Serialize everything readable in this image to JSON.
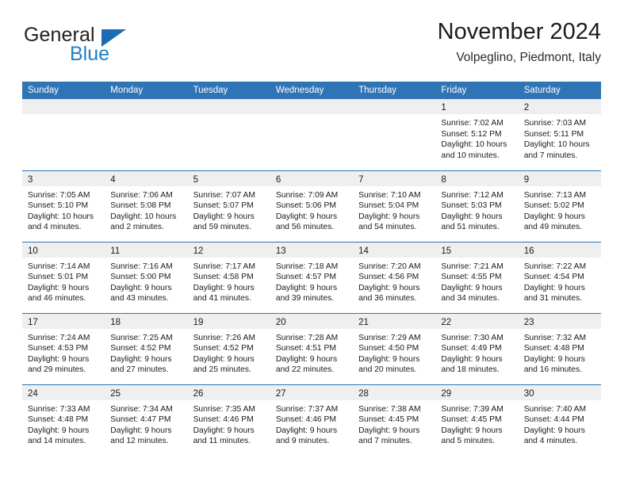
{
  "brand": {
    "word1": "General",
    "word2": "Blue",
    "flag_color": "#1b6cb0",
    "blue_text_color": "#1d80c4"
  },
  "header": {
    "title": "November 2024",
    "subtitle": "Volpeglino, Piedmont, Italy"
  },
  "theme": {
    "header_blue": "#2f74b5",
    "daynum_band_gray": "#efefef",
    "text_color": "#1a1a1a"
  },
  "calendar": {
    "weekday_headers": [
      "Sunday",
      "Monday",
      "Tuesday",
      "Wednesday",
      "Thursday",
      "Friday",
      "Saturday"
    ],
    "weeks": [
      [
        {
          "empty": true
        },
        {
          "empty": true
        },
        {
          "empty": true
        },
        {
          "empty": true
        },
        {
          "empty": true
        },
        {
          "day": "1",
          "sunrise": "Sunrise: 7:02 AM",
          "sunset": "Sunset: 5:12 PM",
          "daylight1": "Daylight: 10 hours",
          "daylight2": "and 10 minutes."
        },
        {
          "day": "2",
          "sunrise": "Sunrise: 7:03 AM",
          "sunset": "Sunset: 5:11 PM",
          "daylight1": "Daylight: 10 hours",
          "daylight2": "and 7 minutes."
        }
      ],
      [
        {
          "day": "3",
          "sunrise": "Sunrise: 7:05 AM",
          "sunset": "Sunset: 5:10 PM",
          "daylight1": "Daylight: 10 hours",
          "daylight2": "and 4 minutes."
        },
        {
          "day": "4",
          "sunrise": "Sunrise: 7:06 AM",
          "sunset": "Sunset: 5:08 PM",
          "daylight1": "Daylight: 10 hours",
          "daylight2": "and 2 minutes."
        },
        {
          "day": "5",
          "sunrise": "Sunrise: 7:07 AM",
          "sunset": "Sunset: 5:07 PM",
          "daylight1": "Daylight: 9 hours",
          "daylight2": "and 59 minutes."
        },
        {
          "day": "6",
          "sunrise": "Sunrise: 7:09 AM",
          "sunset": "Sunset: 5:06 PM",
          "daylight1": "Daylight: 9 hours",
          "daylight2": "and 56 minutes."
        },
        {
          "day": "7",
          "sunrise": "Sunrise: 7:10 AM",
          "sunset": "Sunset: 5:04 PM",
          "daylight1": "Daylight: 9 hours",
          "daylight2": "and 54 minutes."
        },
        {
          "day": "8",
          "sunrise": "Sunrise: 7:12 AM",
          "sunset": "Sunset: 5:03 PM",
          "daylight1": "Daylight: 9 hours",
          "daylight2": "and 51 minutes."
        },
        {
          "day": "9",
          "sunrise": "Sunrise: 7:13 AM",
          "sunset": "Sunset: 5:02 PM",
          "daylight1": "Daylight: 9 hours",
          "daylight2": "and 49 minutes."
        }
      ],
      [
        {
          "day": "10",
          "sunrise": "Sunrise: 7:14 AM",
          "sunset": "Sunset: 5:01 PM",
          "daylight1": "Daylight: 9 hours",
          "daylight2": "and 46 minutes."
        },
        {
          "day": "11",
          "sunrise": "Sunrise: 7:16 AM",
          "sunset": "Sunset: 5:00 PM",
          "daylight1": "Daylight: 9 hours",
          "daylight2": "and 43 minutes."
        },
        {
          "day": "12",
          "sunrise": "Sunrise: 7:17 AM",
          "sunset": "Sunset: 4:58 PM",
          "daylight1": "Daylight: 9 hours",
          "daylight2": "and 41 minutes."
        },
        {
          "day": "13",
          "sunrise": "Sunrise: 7:18 AM",
          "sunset": "Sunset: 4:57 PM",
          "daylight1": "Daylight: 9 hours",
          "daylight2": "and 39 minutes."
        },
        {
          "day": "14",
          "sunrise": "Sunrise: 7:20 AM",
          "sunset": "Sunset: 4:56 PM",
          "daylight1": "Daylight: 9 hours",
          "daylight2": "and 36 minutes."
        },
        {
          "day": "15",
          "sunrise": "Sunrise: 7:21 AM",
          "sunset": "Sunset: 4:55 PM",
          "daylight1": "Daylight: 9 hours",
          "daylight2": "and 34 minutes."
        },
        {
          "day": "16",
          "sunrise": "Sunrise: 7:22 AM",
          "sunset": "Sunset: 4:54 PM",
          "daylight1": "Daylight: 9 hours",
          "daylight2": "and 31 minutes."
        }
      ],
      [
        {
          "day": "17",
          "sunrise": "Sunrise: 7:24 AM",
          "sunset": "Sunset: 4:53 PM",
          "daylight1": "Daylight: 9 hours",
          "daylight2": "and 29 minutes."
        },
        {
          "day": "18",
          "sunrise": "Sunrise: 7:25 AM",
          "sunset": "Sunset: 4:52 PM",
          "daylight1": "Daylight: 9 hours",
          "daylight2": "and 27 minutes."
        },
        {
          "day": "19",
          "sunrise": "Sunrise: 7:26 AM",
          "sunset": "Sunset: 4:52 PM",
          "daylight1": "Daylight: 9 hours",
          "daylight2": "and 25 minutes."
        },
        {
          "day": "20",
          "sunrise": "Sunrise: 7:28 AM",
          "sunset": "Sunset: 4:51 PM",
          "daylight1": "Daylight: 9 hours",
          "daylight2": "and 22 minutes."
        },
        {
          "day": "21",
          "sunrise": "Sunrise: 7:29 AM",
          "sunset": "Sunset: 4:50 PM",
          "daylight1": "Daylight: 9 hours",
          "daylight2": "and 20 minutes."
        },
        {
          "day": "22",
          "sunrise": "Sunrise: 7:30 AM",
          "sunset": "Sunset: 4:49 PM",
          "daylight1": "Daylight: 9 hours",
          "daylight2": "and 18 minutes."
        },
        {
          "day": "23",
          "sunrise": "Sunrise: 7:32 AM",
          "sunset": "Sunset: 4:48 PM",
          "daylight1": "Daylight: 9 hours",
          "daylight2": "and 16 minutes."
        }
      ],
      [
        {
          "day": "24",
          "sunrise": "Sunrise: 7:33 AM",
          "sunset": "Sunset: 4:48 PM",
          "daylight1": "Daylight: 9 hours",
          "daylight2": "and 14 minutes."
        },
        {
          "day": "25",
          "sunrise": "Sunrise: 7:34 AM",
          "sunset": "Sunset: 4:47 PM",
          "daylight1": "Daylight: 9 hours",
          "daylight2": "and 12 minutes."
        },
        {
          "day": "26",
          "sunrise": "Sunrise: 7:35 AM",
          "sunset": "Sunset: 4:46 PM",
          "daylight1": "Daylight: 9 hours",
          "daylight2": "and 11 minutes."
        },
        {
          "day": "27",
          "sunrise": "Sunrise: 7:37 AM",
          "sunset": "Sunset: 4:46 PM",
          "daylight1": "Daylight: 9 hours",
          "daylight2": "and 9 minutes."
        },
        {
          "day": "28",
          "sunrise": "Sunrise: 7:38 AM",
          "sunset": "Sunset: 4:45 PM",
          "daylight1": "Daylight: 9 hours",
          "daylight2": "and 7 minutes."
        },
        {
          "day": "29",
          "sunrise": "Sunrise: 7:39 AM",
          "sunset": "Sunset: 4:45 PM",
          "daylight1": "Daylight: 9 hours",
          "daylight2": "and 5 minutes."
        },
        {
          "day": "30",
          "sunrise": "Sunrise: 7:40 AM",
          "sunset": "Sunset: 4:44 PM",
          "daylight1": "Daylight: 9 hours",
          "daylight2": "and 4 minutes."
        }
      ]
    ]
  }
}
